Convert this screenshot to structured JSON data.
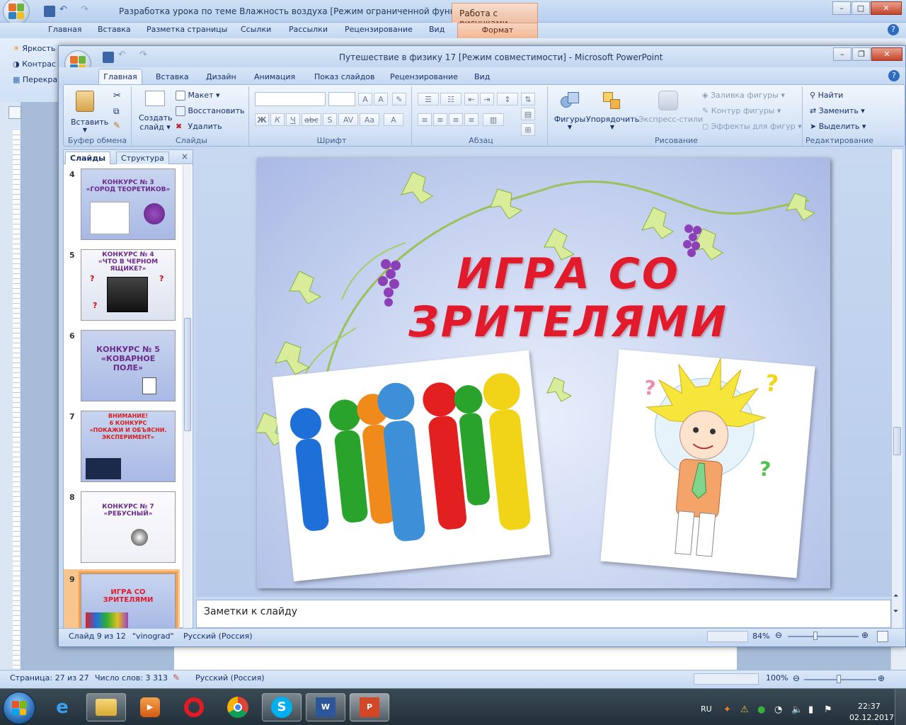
{
  "word": {
    "title": "Разработка урока по теме Влажность воздуха [Режим ограниченной функционал...",
    "context_tab": "Работа с рисунками",
    "tabs": [
      "Главная",
      "Вставка",
      "Разметка страницы",
      "Ссылки",
      "Рассылки",
      "Рецензирование",
      "Вид",
      "Формат"
    ],
    "side_labels": [
      "Яркость",
      "Контрас",
      "Перекра"
    ],
    "status": {
      "page": "Страница: 27 из 27",
      "words": "Число слов: 3 313",
      "language": "Русский (Россия)",
      "zoom": "100%"
    }
  },
  "ppt": {
    "title": "Путешествие  в физику 17 [Режим совместимости] - Microsoft PowerPoint",
    "tabs": [
      "Главная",
      "Вставка",
      "Дизайн",
      "Анимация",
      "Показ слайдов",
      "Рецензирование",
      "Вид"
    ],
    "active_tab": "Главная",
    "ribbon": {
      "clipboard": {
        "paste": "Вставить",
        "label": "Буфер обмена"
      },
      "slides": {
        "new_slide_1": "Создать",
        "new_slide_2": "слайд",
        "layout": "Макет",
        "reset": "Восстановить",
        "delete": "Удалить",
        "label": "Слайды"
      },
      "font": {
        "label": "Шрифт"
      },
      "paragraph": {
        "label": "Абзац"
      },
      "drawing": {
        "shapes": "Фигуры",
        "arrange": "Упорядочить",
        "quick_styles": "Экспресс-стили",
        "fill": "Заливка фигуры",
        "outline": "Контур фигуры",
        "effects": "Эффекты для фигур",
        "label": "Рисование"
      },
      "editing": {
        "find": "Найти",
        "replace": "Заменить",
        "select": "Выделить",
        "label": "Редактирование"
      }
    },
    "panel_tabs": [
      "Слайды",
      "Структура"
    ],
    "thumbnails": [
      {
        "num": "4",
        "title": "КОНКУРС № 3\n«ГОРОД ТЕОРЕТИКОВ»"
      },
      {
        "num": "5",
        "title": "КОНКУРС № 4\n«ЧТО В ЧЕРНОМ ЯЩИКЕ?»"
      },
      {
        "num": "6",
        "title": "КОНКУРС № 5\n«КОВАРНОЕ\nПОЛЕ»"
      },
      {
        "num": "7",
        "title": "ВНИМАНИЕ!\n6 КОНКУРС\n«ПОКАЖИ И ОБЪЯСНИ.\nЭКСПЕРИМЕНТ»"
      },
      {
        "num": "8",
        "title": "КОНКУРС № 7\n«РЕБУСНЫЙ»"
      },
      {
        "num": "9",
        "title": "ИГРА СО\nЗРИТЕЛЯМИ"
      }
    ],
    "slide": {
      "title": "ИГРА СО ЗРИТЕЛЯМИ"
    },
    "notes_placeholder": "Заметки к слайду",
    "status": {
      "slide": "Слайд 9 из 12",
      "theme": "\"vinograd\"",
      "language": "Русский (Россия)",
      "zoom": "84%"
    }
  },
  "taskbar": {
    "lang": "RU",
    "time": "22:37",
    "date": "02.12.2017"
  },
  "colors": {
    "title_red": "#e11b2c",
    "ribbon_blue": "#c7d9f1",
    "taskbar": "#22303a"
  }
}
